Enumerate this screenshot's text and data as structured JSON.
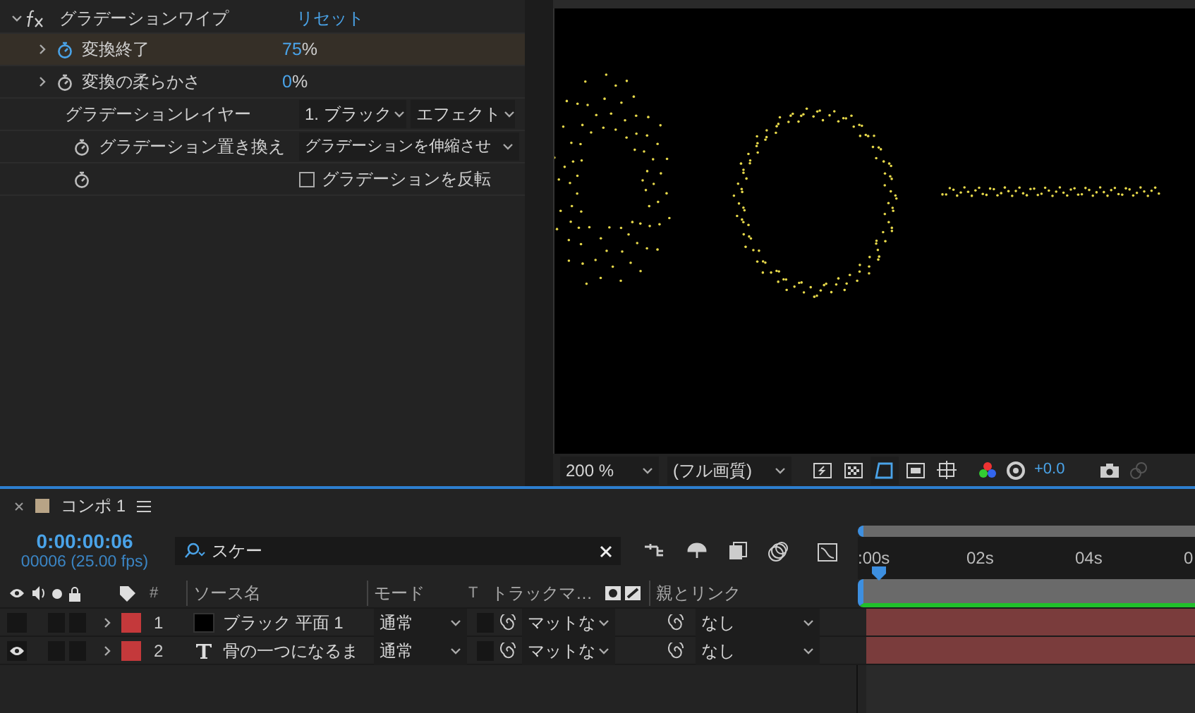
{
  "effect": {
    "name": "グラデーションワイプ",
    "expanded": true,
    "reset": "リセット",
    "properties": [
      {
        "kind": "value",
        "label": "変換終了",
        "selected": true,
        "animated": true,
        "number": "75",
        "unit": "%"
      },
      {
        "kind": "value",
        "label": "変換の柔らかさ",
        "selected": false,
        "animated": false,
        "number": "0",
        "unit": "%"
      },
      {
        "kind": "layer",
        "label": "グラデーションレイヤー",
        "selected": false,
        "dropdowns": [
          "1. ブラック",
          "エフェクト"
        ]
      },
      {
        "kind": "dropdown",
        "label": "グラデーション置き換え",
        "selected": false,
        "dropdowns": [
          "グラデーションを伸縮させ"
        ]
      },
      {
        "kind": "checkbox",
        "label": "グラデーションを反転",
        "selected": false,
        "checked": false
      }
    ]
  },
  "viewer": {
    "zoom": "200 %",
    "resolution": "(フル画質)",
    "exposure": "+0.0",
    "tools": [
      {
        "selected": false
      },
      {
        "selected": false
      },
      {
        "selected": true
      },
      {
        "selected": false
      },
      {
        "selected": false
      }
    ]
  },
  "timeline": {
    "tab": "コンポ 1",
    "timecode": "0:00:00:06",
    "frames": "00006 (25.00 fps)",
    "search": "スケー",
    "columns": {
      "number": "#",
      "source": "ソース名",
      "mode": "モード",
      "t": "T",
      "track": "トラックマ…",
      "parent": "親とリンク"
    },
    "layers": [
      {
        "number": "1",
        "kind": "solid",
        "name": "ブラック 平面 1",
        "visible": false,
        "color": "#c4393b",
        "mode": "通常",
        "track": "マットな",
        "parent": "なし"
      },
      {
        "number": "2",
        "kind": "text",
        "name": "骨の一つになるま",
        "visible": true,
        "color": "#c4393b",
        "mode": "通常",
        "track": "マットな",
        "parent": "なし"
      }
    ],
    "ruler": [
      ":00s",
      "02s",
      "04s",
      "0"
    ]
  }
}
